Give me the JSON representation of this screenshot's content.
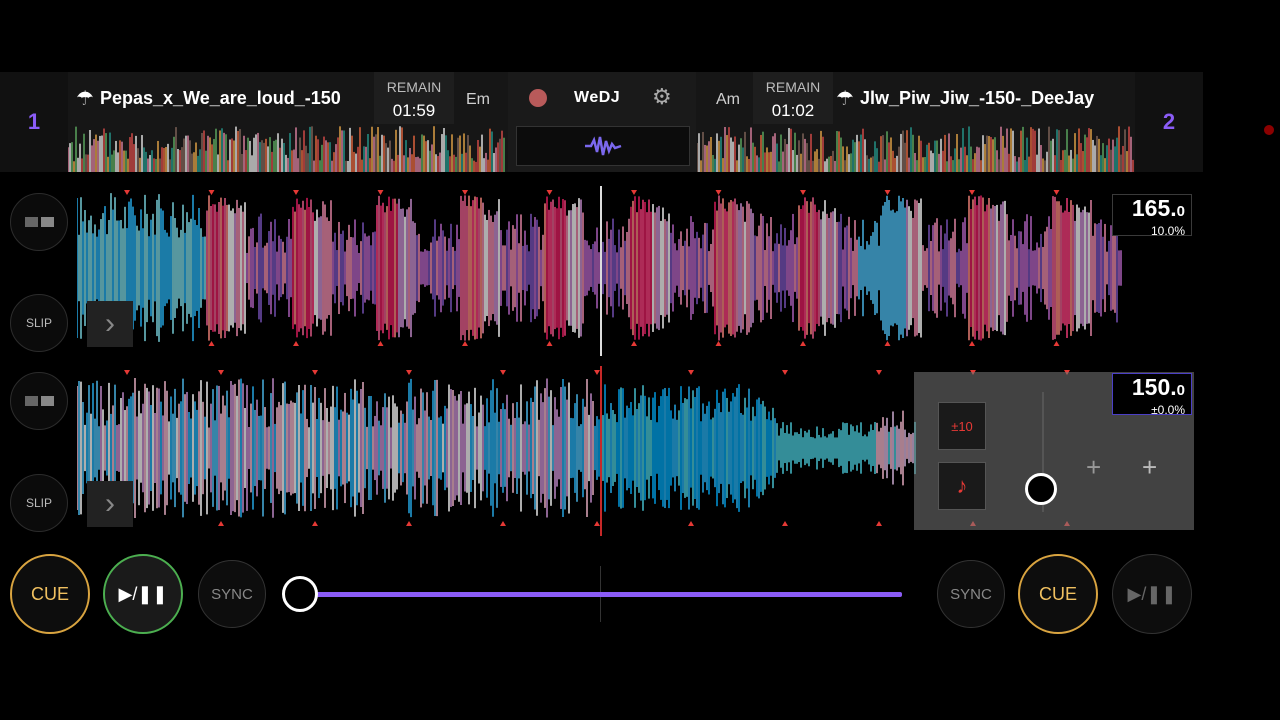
{
  "deck1": {
    "number": "1",
    "title": "Pepas_x_We_are_loud_-150",
    "remain_label": "REMAIN",
    "remain_time": "01:59",
    "key": "Em",
    "bpm": "165.",
    "bpm_decimal": "0",
    "pitch": "10.0%",
    "slip_label": "SLIP",
    "cue_label": "CUE",
    "play_label": "▶/❚❚",
    "sync_label": "SYNC"
  },
  "deck2": {
    "number": "2",
    "title": "Jlw_Piw_Jiw_-150-_DeeJay",
    "remain_label": "REMAIN",
    "remain_time": "01:02",
    "key": "Am",
    "bpm": "150.",
    "bpm_decimal": "0",
    "pitch": "±0.0%",
    "slip_label": "SLIP",
    "cue_label": "CUE",
    "play_label": "▶/❚❚",
    "sync_label": "SYNC",
    "pitch_range_label": "±10"
  },
  "center": {
    "brand": "WeDJ",
    "record_icon": "record-icon",
    "settings_icon": "gear-icon",
    "waveform_icon": "waveform-icon"
  },
  "crossfader": {
    "position": 0.0
  },
  "colors": {
    "accent": "#8b5cf6",
    "cue": "#d9a440",
    "play_active": "#4caf50",
    "beat_marker": "#e53935"
  }
}
